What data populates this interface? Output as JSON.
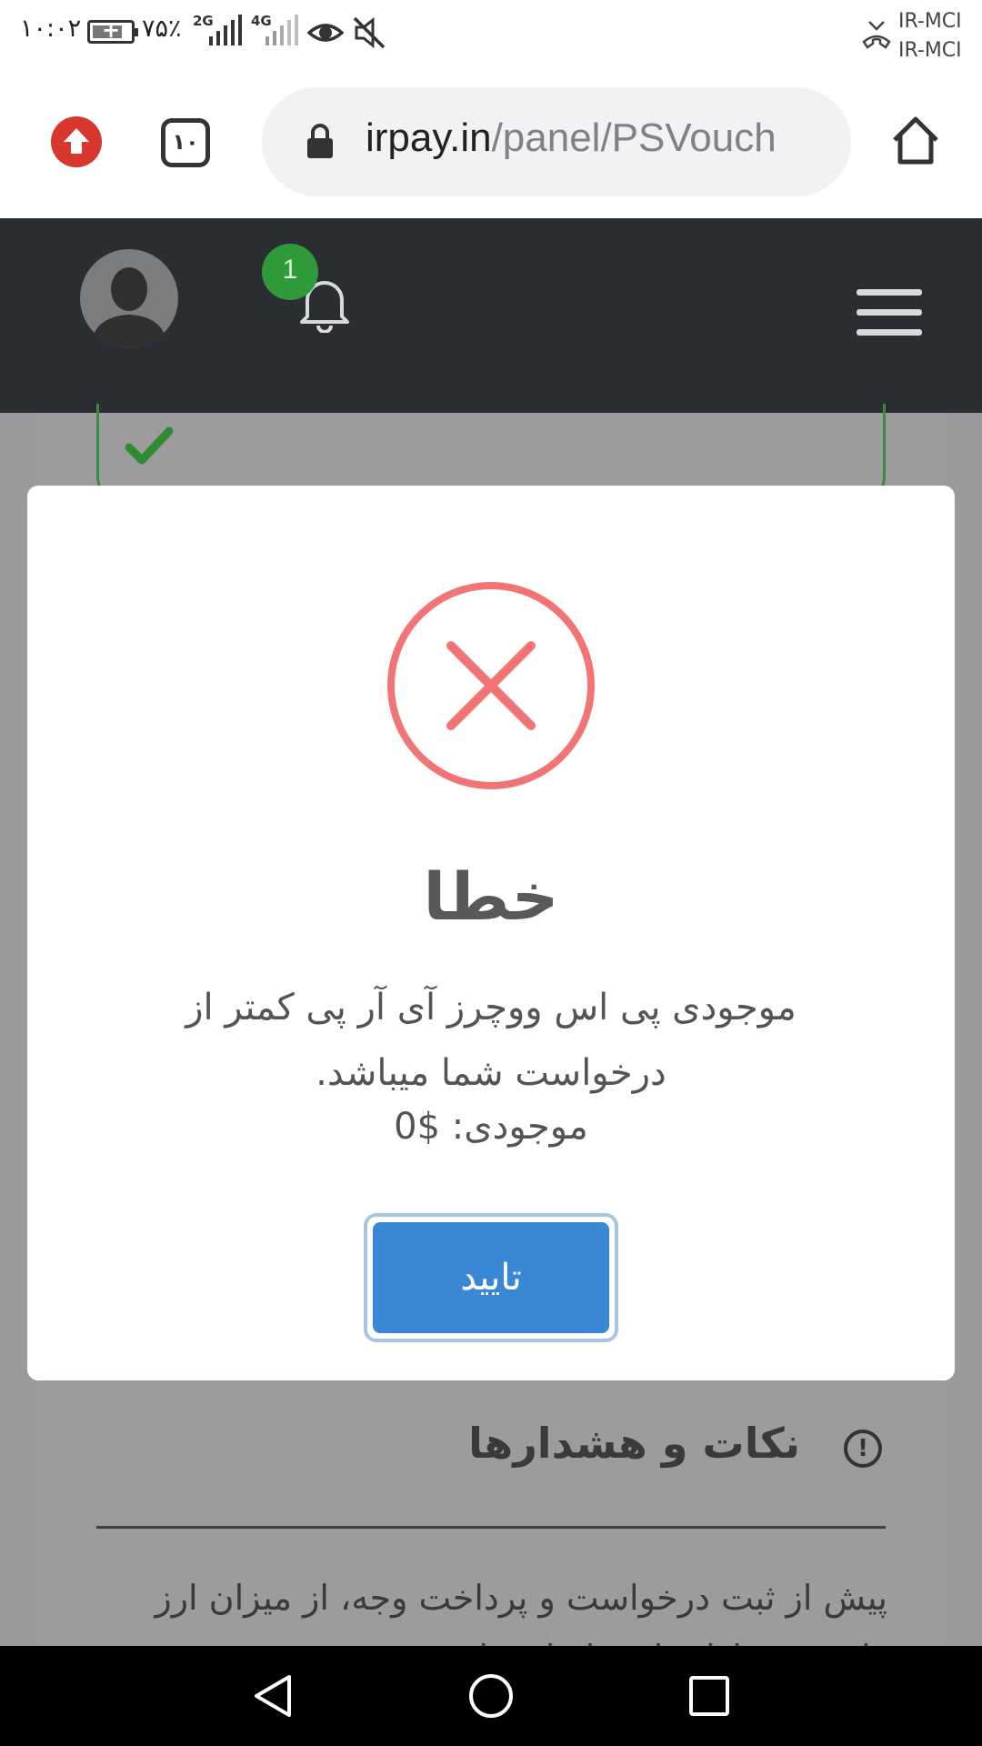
{
  "status_bar": {
    "time": "۱۰:۰۲",
    "battery_pct": "۷۵٪",
    "net_2g": "2G",
    "net_4g": "4G",
    "carrier_1": "IR-MCI",
    "carrier_2": "IR-MCI"
  },
  "browser": {
    "tab_count": "۱۰",
    "url_host": "irpay.in",
    "url_path": "/panel/PSVouch"
  },
  "header": {
    "notification_count": "1"
  },
  "dialog": {
    "title": "خطا",
    "message": "موجودی پی اس ووچرز آی آر پی کمتر از درخواست شما میباشد.",
    "balance": "موجودی: $0",
    "confirm_label": "تایید"
  },
  "background": {
    "notes_title": "نکات و هشدارها",
    "notes_icon": "!",
    "notes_text": "پیش از ثبت درخواست و پرداخت وجه، از میزان ارز وارد شده اطمینان حاصل نمایید"
  },
  "colors": {
    "error": "#f27474",
    "success": "#2f9a3a",
    "primary": "#3a87d6",
    "header_bg": "#2a2d32"
  }
}
